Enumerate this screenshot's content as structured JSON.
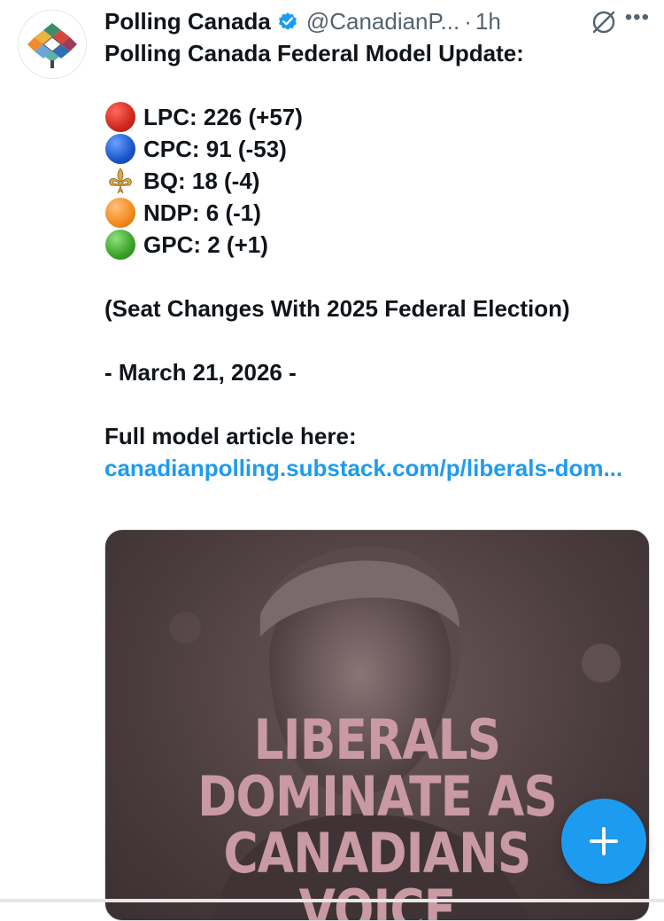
{
  "post": {
    "author": "Polling Canada",
    "handle": "@CanadianP...",
    "separator": "·",
    "time": "1h",
    "verified_icon": "verified-badge-icon",
    "title": "Polling Canada Federal Model Update:",
    "parties": [
      {
        "icon": "red-circle",
        "color": "#d0271d",
        "text": "LPC: 226 (+57)"
      },
      {
        "icon": "blue-circle",
        "color": "#1a56c9",
        "text": "CPC: 91 (-53)"
      },
      {
        "icon": "fleur-de-lis",
        "color": "#c79a3c",
        "text": "BQ: 18 (-4)"
      },
      {
        "icon": "orange-circle",
        "color": "#f28a1e",
        "text": "NDP: 6 (-1)"
      },
      {
        "icon": "green-circle",
        "color": "#3aa12a",
        "text": "GPC: 2 (+1)"
      }
    ],
    "note": "(Seat Changes With 2025 Federal Election)",
    "date": "- March 21, 2026 -",
    "article_label": "Full model article here:",
    "link": "canadianpolling.substack.com/p/liberals-dom..."
  },
  "card": {
    "headline_lines": [
      "LIBERALS",
      "DOMINATE AS",
      "CANADIANS VOICE"
    ]
  },
  "compose": {
    "icon": "plus-icon"
  },
  "colors": {
    "accent": "#1d9bf0",
    "text": "#0f1419",
    "muted": "#536471",
    "headline": "#c99aa3"
  }
}
